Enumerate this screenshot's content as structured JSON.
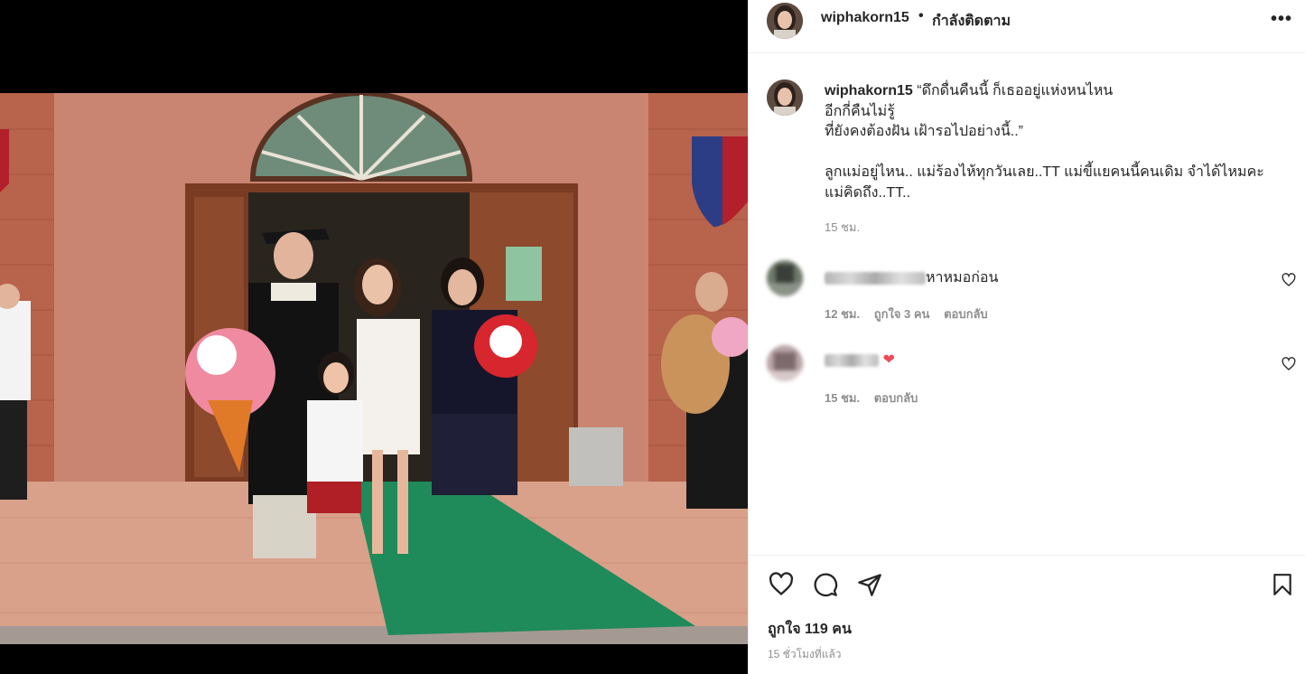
{
  "post": {
    "username": "wiphakorn15",
    "separator": "•",
    "follow_status": "กำลังติดตาม",
    "more_icon": "more-options-icon",
    "caption": {
      "username": "wiphakorn15",
      "line1": "“ดึกดื่นคืนนี้ ก็เธออยู่แห่งหนไหน",
      "line2": "อีกกี่คืนไม่รู้",
      "line3": "ที่ยังคงต้องฝัน เฝ้ารอไปอย่างนี้..”",
      "line4": "ลูกแม่อยู่ไหน.. แม่ร้องไห้ทุกวันเลย..TT แม่ขี้แยคนนี้คนเดิม จำได้ไหมคะ",
      "line5": "แม่คิดถึง..TT..",
      "time": "15 ชม."
    },
    "comments": [
      {
        "text": "หาหมอก่อน",
        "time": "12 ชม.",
        "likes": "ถูกใจ 3 คน",
        "reply": "ตอบกลับ"
      },
      {
        "text": "❤",
        "time": "15 ชม.",
        "reply": "ตอบกลับ"
      }
    ],
    "likes": "ถูกใจ 119 คน",
    "posted": "15 ชั่วโมงที่แล้ว",
    "colors": {
      "text": "#262626",
      "muted": "#8e8e8e",
      "heart": "#ed4956",
      "border": "#efefef"
    }
  }
}
